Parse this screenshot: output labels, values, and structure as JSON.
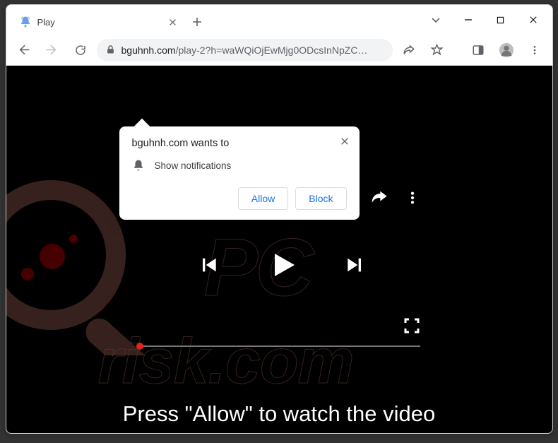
{
  "window": {
    "tab_title": "Play",
    "url_host": "bguhnh.com",
    "url_path": "/play-2?h=waWQiOjEwMjg0ODcsInNpZC…"
  },
  "prompt": {
    "title": "bguhnh.com wants to",
    "permission_label": "Show notifications",
    "allow_label": "Allow",
    "block_label": "Block"
  },
  "page": {
    "instruction": "Press \"Allow\" to watch the video"
  },
  "watermark": {
    "line1": "PC",
    "line2": "risk.com"
  },
  "colors": {
    "accent_blue": "#1a73e8",
    "progress_red": "#e62117"
  }
}
